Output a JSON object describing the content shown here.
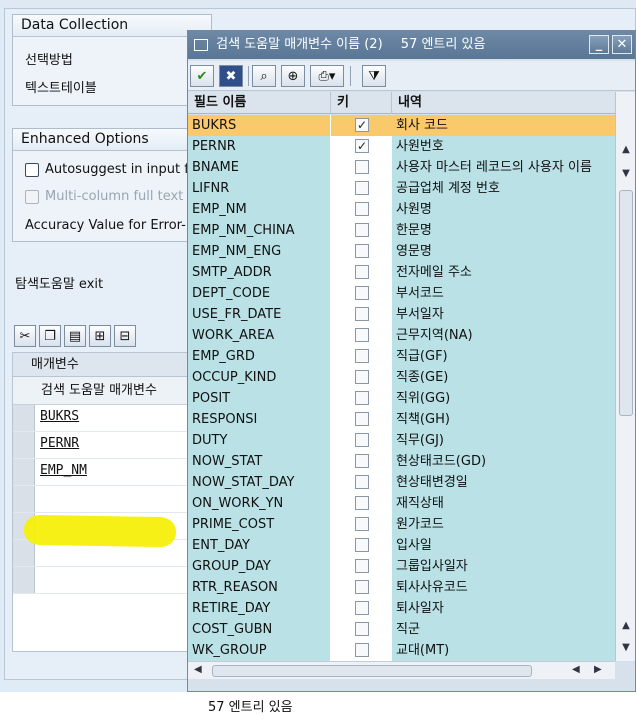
{
  "background": {
    "data_collection": {
      "title": "Data Collection",
      "fields": [
        "선택방법",
        "텍스트테이블"
      ]
    },
    "enhanced_options": {
      "title": "Enhanced Options",
      "autosuggest_label": "Autosuggest in input f",
      "multicolumn_label": "Multi-column full text s",
      "accuracy_label": "Accuracy Value for Error-"
    },
    "exit_label": "탐색도움말 exit",
    "param_table": {
      "header": "매개변수",
      "subheader": "검색 도움말 매개변수",
      "rows": [
        "BUKRS",
        "PERNR",
        "EMP_NM",
        "",
        "",
        "",
        ""
      ]
    },
    "highlight_color": "#f6ef0a"
  },
  "popup": {
    "title": "검색 도움말 매개변수 이름 (2)",
    "entry_count_title": "57 엔트리 있음",
    "minimize_label": "_",
    "close_label": "✕",
    "columns": {
      "field": "필드 이름",
      "key": "키",
      "desc": "내역"
    },
    "rows": [
      {
        "field": "BUKRS",
        "key": true,
        "desc": "회사 코드",
        "selected": true
      },
      {
        "field": "PERNR",
        "key": true,
        "desc": "사원번호"
      },
      {
        "field": "BNAME",
        "key": false,
        "desc": "사용자 마스터 레코드의 사용자 이름"
      },
      {
        "field": "LIFNR",
        "key": false,
        "desc": "공급업체 계정 번호"
      },
      {
        "field": "EMP_NM",
        "key": false,
        "desc": "사원명"
      },
      {
        "field": "EMP_NM_CHINA",
        "key": false,
        "desc": "한문명"
      },
      {
        "field": "EMP_NM_ENG",
        "key": false,
        "desc": "영문명"
      },
      {
        "field": "SMTP_ADDR",
        "key": false,
        "desc": "전자메일 주소"
      },
      {
        "field": "DEPT_CODE",
        "key": false,
        "desc": "부서코드"
      },
      {
        "field": "USE_FR_DATE",
        "key": false,
        "desc": "부서일자"
      },
      {
        "field": "WORK_AREA",
        "key": false,
        "desc": "근무지역(NA)"
      },
      {
        "field": "EMP_GRD",
        "key": false,
        "desc": "직급(GF)"
      },
      {
        "field": "OCCUP_KIND",
        "key": false,
        "desc": "직종(GE)"
      },
      {
        "field": "POSIT",
        "key": false,
        "desc": "직위(GG)"
      },
      {
        "field": "RESPONSI",
        "key": false,
        "desc": "직책(GH)"
      },
      {
        "field": "DUTY",
        "key": false,
        "desc": "직무(GJ)"
      },
      {
        "field": "NOW_STAT",
        "key": false,
        "desc": "현상태코드(GD)"
      },
      {
        "field": "NOW_STAT_DAY",
        "key": false,
        "desc": "현상태변경일"
      },
      {
        "field": "ON_WORK_YN",
        "key": false,
        "desc": "재직상태"
      },
      {
        "field": "PRIME_COST",
        "key": false,
        "desc": "원가코드"
      },
      {
        "field": "ENT_DAY",
        "key": false,
        "desc": "입사일"
      },
      {
        "field": "GROUP_DAY",
        "key": false,
        "desc": "그룹입사일자"
      },
      {
        "field": "RTR_REASON",
        "key": false,
        "desc": "퇴사사유코드"
      },
      {
        "field": "RETIRE_DAY",
        "key": false,
        "desc": "퇴사일자"
      },
      {
        "field": "COST_GUBN",
        "key": false,
        "desc": "직군"
      },
      {
        "field": "WK_GROUP",
        "key": false,
        "desc": "교대(MT)"
      }
    ],
    "status": "57 엔트리 있음",
    "selected_color": "#f9c96c",
    "row_color": "#b9e1e6"
  }
}
